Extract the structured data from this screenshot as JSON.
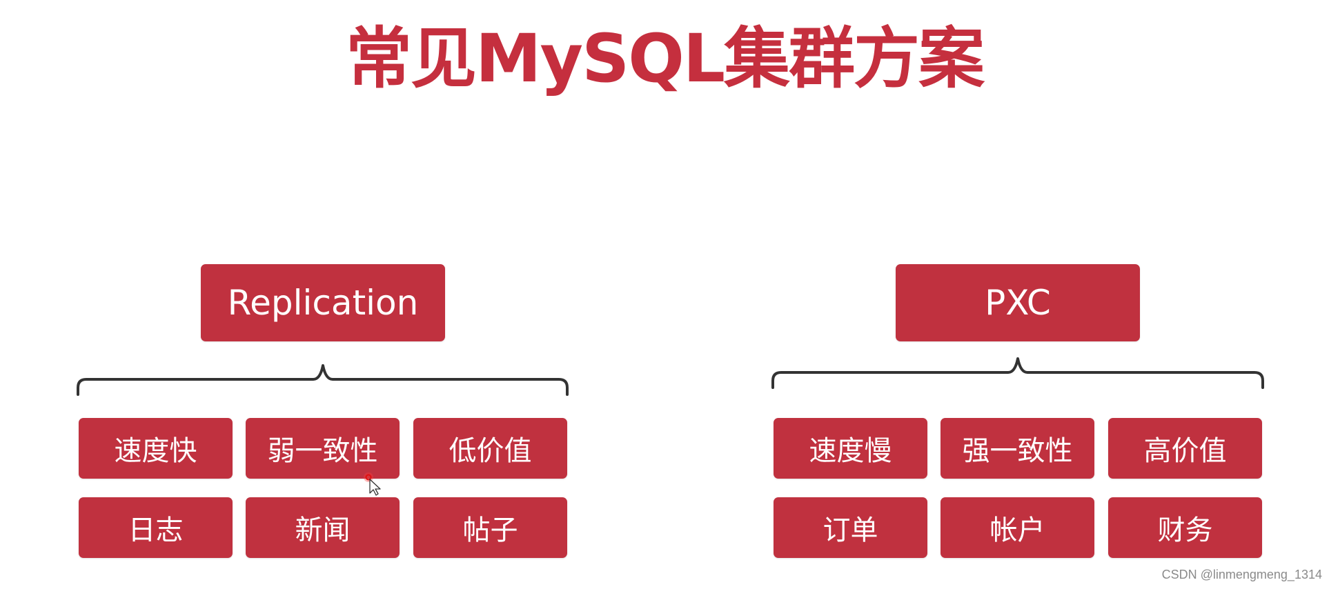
{
  "title": "常见MySQL集群方案",
  "colors": {
    "accent": "#c0313f",
    "title": "#c52f3e",
    "brace": "#333333",
    "box_text": "#ffffff",
    "background": "#ffffff"
  },
  "groups": [
    {
      "name": "Replication",
      "traits": [
        "速度快",
        "弱一致性",
        "低价值"
      ],
      "use_cases": [
        "日志",
        "新闻",
        "帖子"
      ]
    },
    {
      "name": "PXC",
      "traits": [
        "速度慢",
        "强一致性",
        "高价值"
      ],
      "use_cases": [
        "订单",
        "帐户",
        "财务"
      ]
    }
  ],
  "watermark": "CSDN @linmengmeng_1314"
}
